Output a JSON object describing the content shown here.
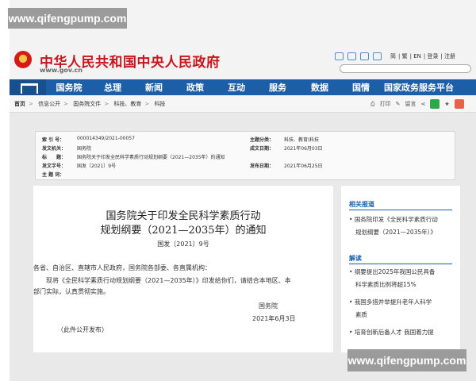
{
  "watermark": {
    "top": "www.qifengpump.com",
    "bottom": "www.qifengpump.com"
  },
  "header": {
    "title": "中华人民共和国中央人民政府",
    "url": "www.gov.cn",
    "links": [
      "简",
      "繁",
      "EN",
      "登录",
      "注册"
    ]
  },
  "nav": {
    "items": [
      "国务院",
      "总理",
      "新闻",
      "政策",
      "互动",
      "服务",
      "数据",
      "国情",
      "国家政务服务平台"
    ]
  },
  "breadcrumb": {
    "items": [
      "首页",
      "信息公开",
      "国务院文件",
      "科技、教育",
      "科技"
    ],
    "tools": [
      "打印",
      "留言"
    ]
  },
  "meta": {
    "index_label": "索 引 号：",
    "index_value": "000014349/2021-00057",
    "topic_label": "主题分类：",
    "topic_value": "科技、教育\\科技",
    "issuer_label": "发文机关：",
    "issuer_value": "国务院",
    "date_written_label": "成文日期：",
    "date_written_value": "2021年06月03日",
    "title_label": "标　　题：",
    "title_value": "国务院关于印发全民科学素质行动规划纲要（2021—2035年）的通知",
    "docno_label": "发文字号：",
    "docno_value": "国发〔2021〕9号",
    "pub_label": "发布日期：",
    "pub_value": "2021年06月25日",
    "keywords_label": "主 题 词：",
    "keywords_value": ""
  },
  "document": {
    "title_line1": "国务院关于印发全民科学素质行动",
    "title_line2": "规划纲要（2021—2035年）的通知",
    "number": "国发〔2021〕9号",
    "recipients": "各省、自治区、直辖市人民政府，国务院各部委、各直属机构：",
    "body_line1": "现将《全民科学素质行动规划纲要（2021—2035年）》印发给你们，请结合本地区、本",
    "body_line2": "部门实际，认真贯彻实施。",
    "sign": "国务院",
    "date": "2021年6月3日",
    "note": "（此件公开发布）"
  },
  "sidebar": {
    "related_title": "相关报道",
    "related_1a": "国务院印发《全民科学素质行动",
    "related_1b": "规划纲要（2021—2035年）》",
    "explain_title": "解读",
    "explain_1a": "纲要提出2025年我国公民具备",
    "explain_1b": "科学素质比例将超15%",
    "explain_2a": "我国多措并举提升老年人科学",
    "explain_2b": "素质",
    "explain_3a": "培育创新后备人才 我国着力提"
  },
  "colors": {
    "brand_red": "#c8151d",
    "nav_blue": "#1c5fa8"
  }
}
